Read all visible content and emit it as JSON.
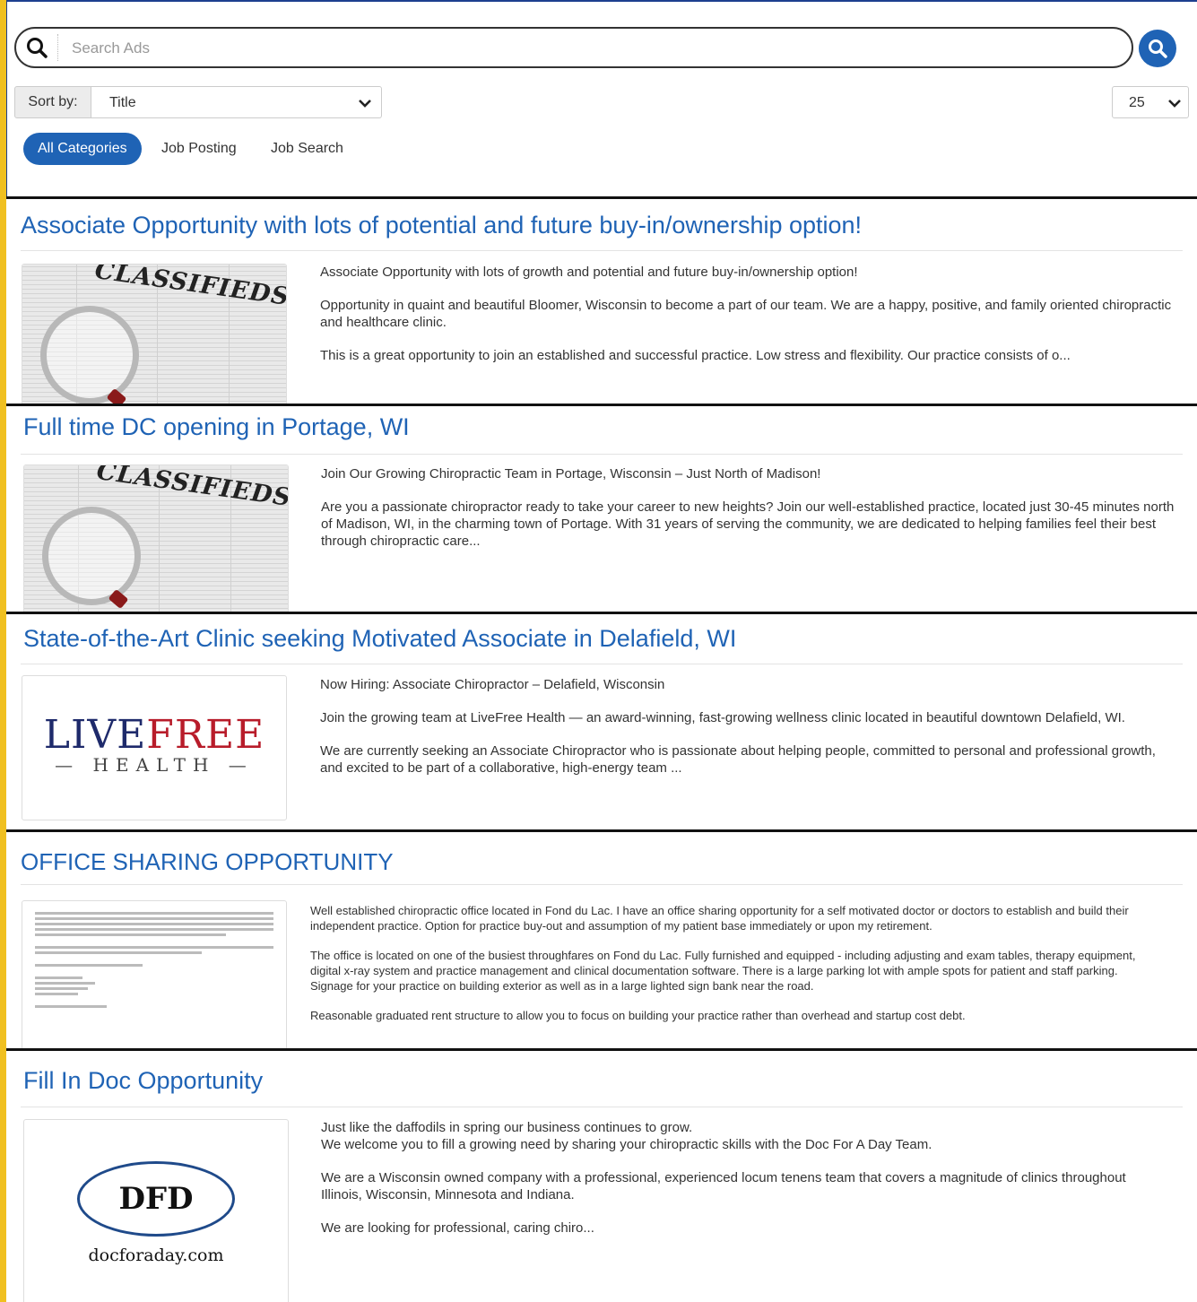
{
  "search": {
    "placeholder": "Search Ads"
  },
  "sort": {
    "label": "Sort by:",
    "value": "Title"
  },
  "per_page": {
    "value": "25"
  },
  "categories": [
    {
      "label": "All Categories",
      "active": true
    },
    {
      "label": "Job Posting",
      "active": false
    },
    {
      "label": "Job Search",
      "active": false
    }
  ],
  "listings": [
    {
      "title": "Associate Opportunity with lots of potential and future buy-in/ownership option!",
      "image": "classifieds-newspaper",
      "image_text": "CLASSIFIEDS",
      "paragraphs": [
        "Associate Opportunity with lots of growth and potential and future buy-in/ownership option!",
        "Opportunity in quaint and beautiful Bloomer, Wisconsin to become a part of our team. We are a happy, positive, and family oriented chiropractic and healthcare clinic.",
        "This is a great opportunity to join an established and successful practice. Low stress and flexibility. Our practice consists of o..."
      ]
    },
    {
      "title": "Full time DC opening in Portage, WI",
      "image": "classifieds-newspaper",
      "image_text": "CLASSIFIEDS",
      "paragraphs": [
        "Join Our Growing Chiropractic Team in Portage, Wisconsin – Just North of Madison!",
        "Are you a passionate chiropractor ready to take your career to new heights? Join our well-established practice, located just 30-45 minutes north of Madison, WI, in the charming town of Portage. With 31 years of serving the community, we are dedicated to helping families feel their best through chiropractic care..."
      ]
    },
    {
      "title": "State-of-the-Art Clinic seeking Motivated Associate in Delafield, WI",
      "image": "livefree-health-logo",
      "logo_word_a": "LIVE",
      "logo_word_b": "FREE",
      "logo_sub": "HEALTH",
      "paragraphs": [
        "Now Hiring: Associate Chiropractor – Delafield, Wisconsin",
        "Join the growing team at LiveFree Health — an award-winning, fast-growing wellness clinic located in beautiful downtown Delafield, WI.",
        "We are currently seeking an Associate Chiropractor who is passionate about helping people, committed to personal and professional growth, and excited to be part of a collaborative, high-energy team ..."
      ]
    },
    {
      "title": "OFFICE SHARING OPPORTUNITY",
      "image": "letter-document",
      "paragraphs": [
        "Well established chiropractic office located in Fond du Lac. I have an office sharing opportunity for a self motivated doctor or doctors to establish and build their independent practice. Option for practice buy-out and assumption of my patient base immediately or upon my retirement.",
        "The office is located on one of the busiest throughfares on Fond du Lac. Fully furnished and equipped - including adjusting and exam tables, therapy equipment, digital x-ray system and practice management and clinical documentation software. There is a large parking lot with ample spots for patient and staff parking. Signage for your practice on building exterior as well as in a large lighted sign bank near the road.",
        "Reasonable graduated rent structure to allow you to focus on building your practice rather than overhead and startup cost debt."
      ]
    },
    {
      "title": "Fill In Doc Opportunity",
      "image": "dfd-logo",
      "logo_word": "DFD",
      "logo_site": "docforaday.com",
      "paragraphs": [
        "Just like the daffodils in spring our business continues to grow.",
        "We welcome you to fill a growing need by sharing your chiropractic skills with the Doc For A Day Team.",
        "We are a Wisconsin owned company with a professional, experienced locum tenens team that covers a magnitude of clinics throughout Illinois, Wisconsin, Minnesota and Indiana.",
        "We are looking for professional, caring chiro..."
      ]
    }
  ],
  "colors": {
    "accent": "#1f63b5",
    "frame": "#f0c020"
  }
}
